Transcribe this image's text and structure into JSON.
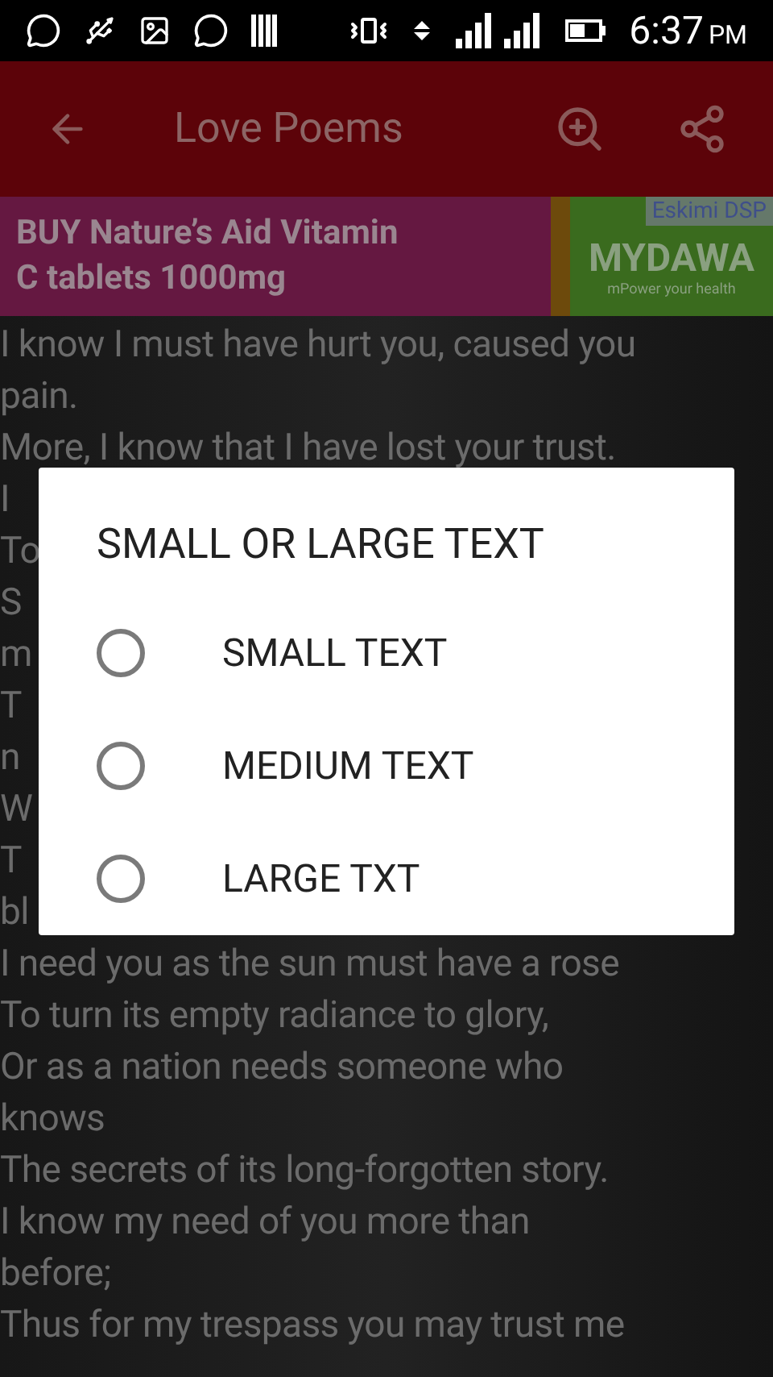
{
  "status_bar": {
    "time": "6:37",
    "period": "PM"
  },
  "toolbar": {
    "title": "Love Poems"
  },
  "ad": {
    "headline_lines": [
      "BUY Nature’s Aid Vitamin",
      "C tablets 1000mg"
    ],
    "label": "Eskimi DSP",
    "brand": "MYDAWA",
    "tagline": "mPower your health"
  },
  "poem": {
    "lines": [
      "I know I must have hurt you, caused you",
      "pain.",
      "More, I know that I have lost your trust.",
      "I",
      "To",
      "S",
      "m",
      "T",
      "n",
      "W",
      "T",
      "bl",
      "I need you as the sun must have a rose",
      "To turn its empty radiance to glory,",
      "Or as a nation needs someone who",
      "knows",
      "The secrets of its long-forgotten story.",
      "I know my need of you more than",
      "before;",
      "Thus for my trespass you may trust me"
    ]
  },
  "dialog": {
    "title": "SMALL OR LARGE TEXT",
    "options": [
      {
        "label": "SMALL TEXT",
        "selected": false
      },
      {
        "label": "MEDIUM TEXT",
        "selected": false
      },
      {
        "label": "LARGE TXT",
        "selected": false
      }
    ]
  }
}
